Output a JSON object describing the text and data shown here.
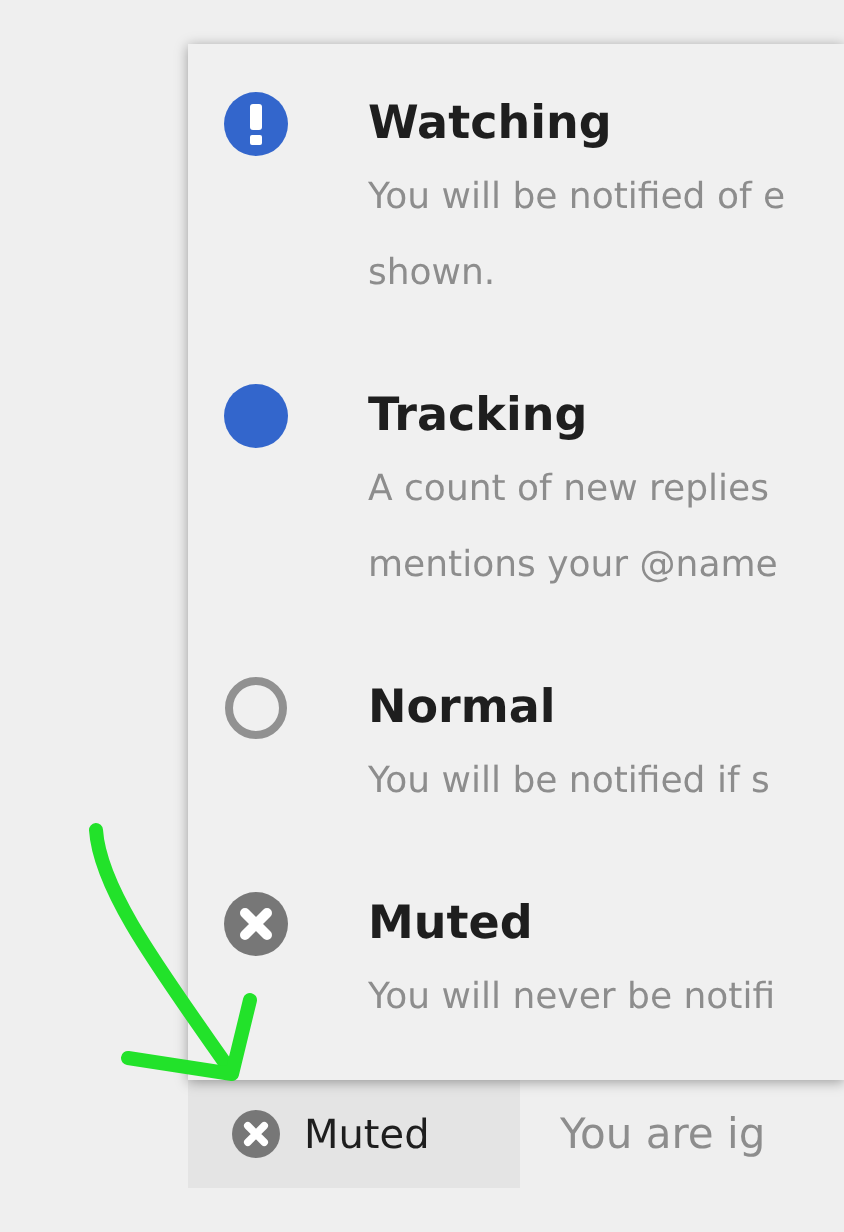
{
  "menu": {
    "items": [
      {
        "kind": "exclamation",
        "title": "Watching",
        "description_lines": [
          "You will be notified of e",
          "shown."
        ]
      },
      {
        "kind": "dot",
        "title": "Tracking",
        "description_lines": [
          "A count of new replies",
          "mentions your @name"
        ]
      },
      {
        "kind": "circle",
        "title": "Normal",
        "description_lines": [
          "You will be notified if s"
        ]
      },
      {
        "kind": "cross",
        "title": "Muted",
        "description_lines": [
          "You will never be notifi"
        ]
      }
    ]
  },
  "status_button": {
    "kind": "cross",
    "label": "Muted"
  },
  "status_text": "You are ig"
}
